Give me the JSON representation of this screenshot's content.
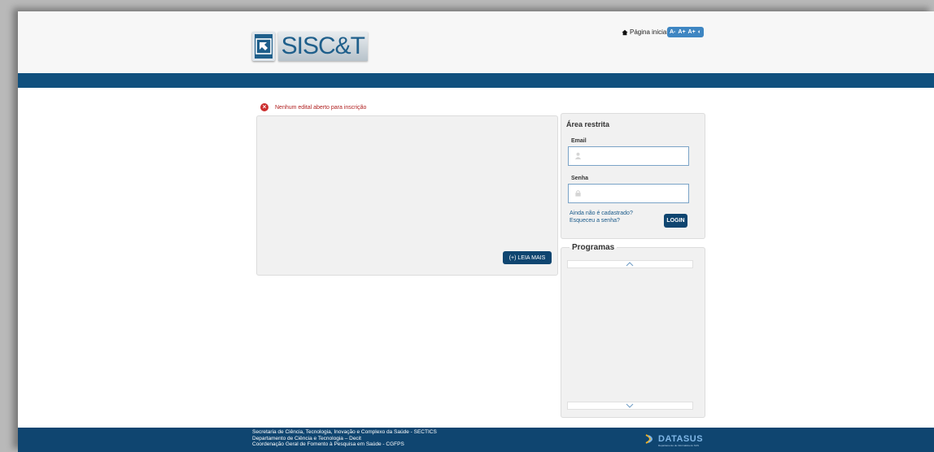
{
  "header": {
    "logo_text": "SISC&T",
    "home_link": "Página inicial",
    "accessibility": [
      "A-",
      "A+",
      "A+",
      "◐"
    ]
  },
  "alert": {
    "message": "Nenhum edital aberto para inscrição"
  },
  "news": {
    "read_more_label": "(+) LEIA MAIS"
  },
  "login": {
    "title": "Área restrita",
    "email_label": "Email",
    "email_value": "",
    "password_label": "Senha",
    "password_value": "",
    "register_link": "Ainda não é cadastrado?",
    "forgot_link": "Esqueceu a senha?",
    "login_button": "LOGIN"
  },
  "programs": {
    "title": "Programas"
  },
  "footer": {
    "lines": [
      "Secretaria de Ciência, Tecnologia, Inovação e Complexo da Saúde - SECTICS",
      "Departamento de Ciência e Tecnologia – Decit",
      "Coordenação Geral de Fomento à Pesquisa em Saúde - CGFPS"
    ],
    "datasus_name": "DATASUS",
    "datasus_sub": "Departamento de Informática do SUS"
  },
  "colors": {
    "brand_blue": "#10507e",
    "button_blue": "#0f4570",
    "accessibility_blue": "#3e86c2",
    "alert_red": "#cc2e2e"
  },
  "icons": [
    "cursor-logo-icon",
    "home-icon",
    "error-icon",
    "user-icon",
    "lock-icon",
    "chevron-up-icon",
    "chevron-down-icon",
    "datasus-logo-icon"
  ]
}
